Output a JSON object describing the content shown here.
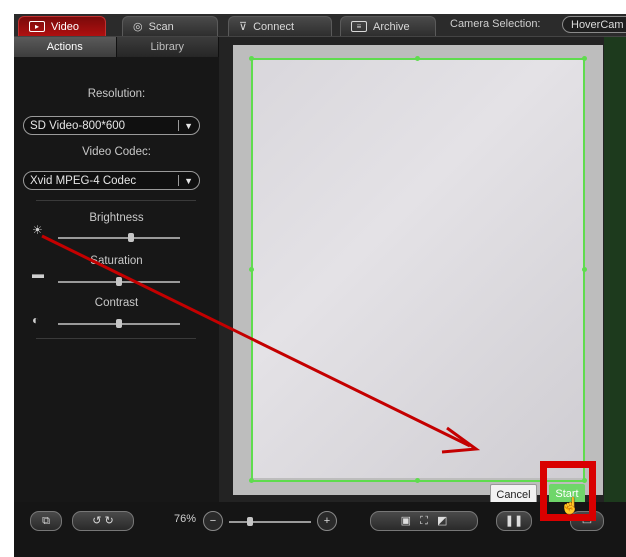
{
  "tabs": [
    {
      "label": "Video",
      "icon": "video-icon",
      "active": true
    },
    {
      "label": "Scan",
      "icon": "scan-icon",
      "active": false
    },
    {
      "label": "Connect",
      "icon": "connect-icon",
      "active": false
    },
    {
      "label": "Archive",
      "icon": "archive-icon",
      "active": false
    }
  ],
  "camera_selection": {
    "label": "Camera Selection:",
    "value": "HoverCam T"
  },
  "left_panel": {
    "subtabs": [
      "Actions",
      "Library"
    ],
    "resolution_label": "Resolution:",
    "resolution_value": "SD Video-800*600",
    "codec_label": "Video Codec:",
    "codec_value": "Xvid MPEG-4 Codec",
    "brightness_label": "Brightness",
    "saturation_label": "Saturation",
    "contrast_label": "Contrast",
    "brightness_level": 0.6,
    "saturation_level": 0.5,
    "contrast_level": 0.5
  },
  "viewer": {
    "cancel_label": "Cancel",
    "start_label": "Start"
  },
  "bottom_bar": {
    "zoom": "76%",
    "zoom_level": 0.25
  },
  "colors": {
    "active_tab": "#b01010",
    "crop_outline": "#5fdc4e",
    "start_button": "#6fd66a",
    "highlight": "#d90000",
    "annotation_arrow": "#c40000"
  }
}
